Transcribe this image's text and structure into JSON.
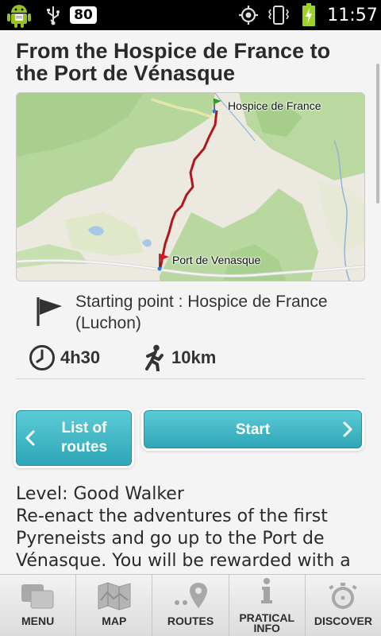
{
  "status_bar": {
    "battery_level": "80",
    "time": "11:57",
    "icons": [
      "android-icon",
      "usb-icon",
      "gps-icon",
      "vibrate-icon",
      "battery-charging-icon"
    ]
  },
  "route": {
    "title": "From the Hospice de France to the Port de Vénasque",
    "map": {
      "labels": {
        "start": "Hospice de France",
        "end": "Port de Venasque"
      },
      "colors": {
        "trail": "#b3161b",
        "start_marker": "#2a7ad6",
        "end_flag": "#e0141e"
      }
    },
    "starting_point": "Starting point : Hospice de France (Luchon)",
    "duration": "4h30",
    "distance": "10km"
  },
  "buttons": {
    "list_routes": "List of\nroutes",
    "start": "Start"
  },
  "description": {
    "level": "Level: Good Walker",
    "text": "Re-enact the adventures of the first Pyreneists and go up to the Port de Vénasque. You will be rewarded with a"
  },
  "nav": {
    "items": [
      {
        "label": "MENU",
        "icon": "menu-icon"
      },
      {
        "label": "MAP",
        "icon": "map-icon"
      },
      {
        "label": "ROUTES",
        "icon": "routes-icon"
      },
      {
        "label": "PRATICAL\nINFO",
        "icon": "info-icon"
      },
      {
        "label": "DISCOVER",
        "icon": "discover-icon"
      }
    ]
  },
  "colors": {
    "accent": "#2da6b7",
    "status_bar": "#000000",
    "background": "#f4f4f4"
  }
}
